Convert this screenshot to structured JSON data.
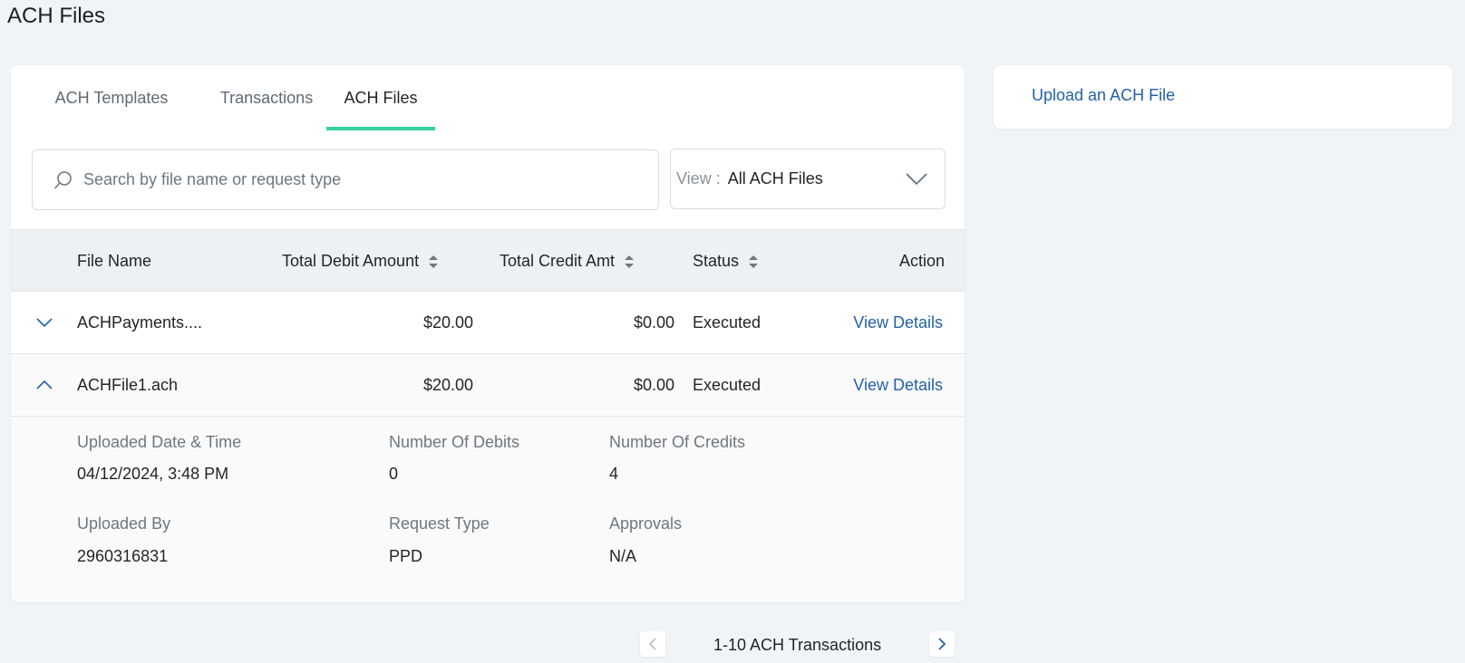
{
  "page": {
    "title": "ACH Files"
  },
  "tabs": [
    {
      "label": "ACH Templates",
      "active": false
    },
    {
      "label": "Transactions",
      "active": false
    },
    {
      "label": "ACH Files",
      "active": true
    }
  ],
  "search": {
    "placeholder": "Search by file name or request type",
    "value": ""
  },
  "view_filter": {
    "label": "View :",
    "value": "All ACH Files"
  },
  "table": {
    "columns": [
      "File Name",
      "Total Debit Amount",
      "Total Credit Amt",
      "Status",
      "Action"
    ],
    "rows": [
      {
        "file_name": "ACHPayments....",
        "debit": "$20.00",
        "credit": "$0.00",
        "status": "Executed",
        "action": "View Details",
        "expanded": false
      },
      {
        "file_name": "ACHFile1.ach",
        "debit": "$20.00",
        "credit": "$0.00",
        "status": "Executed",
        "action": "View Details",
        "expanded": true
      }
    ],
    "details": {
      "uploaded_datetime_label": "Uploaded Date & Time",
      "uploaded_datetime": "04/12/2024, 3:48 PM",
      "num_debits_label": "Number Of Debits",
      "num_debits": "0",
      "num_credits_label": "Number Of Credits",
      "num_credits": "4",
      "uploaded_by_label": "Uploaded By",
      "uploaded_by": "2960316831",
      "request_type_label": "Request Type",
      "request_type": "PPD",
      "approvals_label": "Approvals",
      "approvals": "N/A"
    }
  },
  "side_panel": {
    "upload_label": "Upload an ACH File"
  },
  "pagination": {
    "text": "1-10 ACH Transactions"
  },
  "colors": {
    "accent_tab": "#36d39a",
    "link": "#2361a8",
    "background": "#f1f4f7"
  },
  "icons": [
    "search-icon",
    "chevron-down-icon",
    "sort-icon",
    "chevron-up-icon",
    "chevron-left-icon",
    "chevron-right-icon"
  ]
}
